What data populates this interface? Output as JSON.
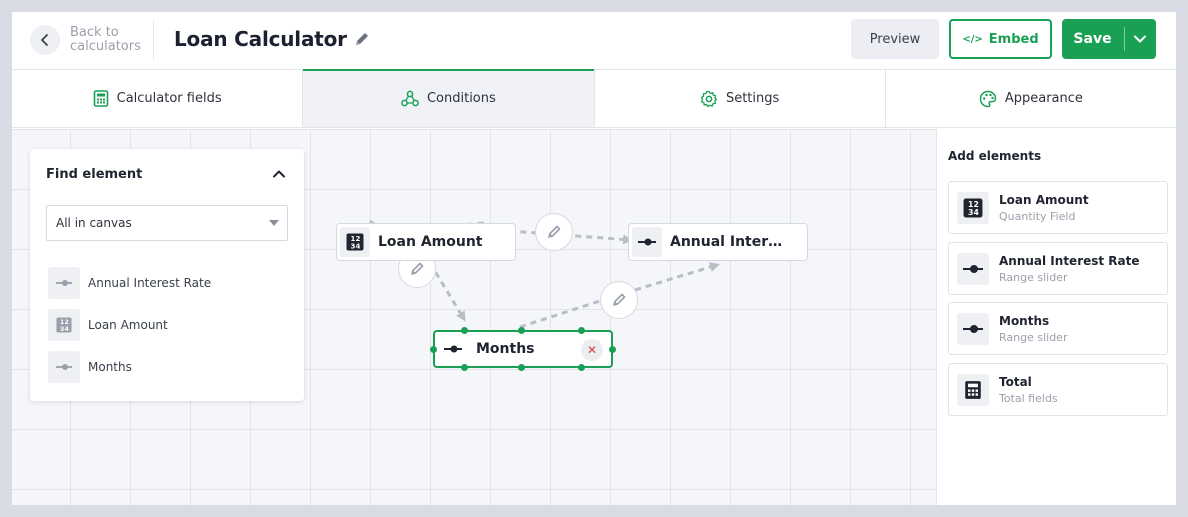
{
  "header": {
    "back_label": "Back to calculators",
    "title": "Loan Calculator",
    "preview_label": "Preview",
    "embed_label": "Embed",
    "save_label": "Save"
  },
  "tabs": [
    {
      "label": "Calculator fields",
      "icon": "calculator-icon"
    },
    {
      "label": "Conditions",
      "icon": "conditions-icon",
      "active": true
    },
    {
      "label": "Settings",
      "icon": "gear-icon"
    },
    {
      "label": "Appearance",
      "icon": "palette-icon"
    }
  ],
  "find_panel": {
    "title": "Find element",
    "select_value": "All in canvas",
    "items": [
      {
        "label": "Annual Interest Rate",
        "icon": "range-slider-icon"
      },
      {
        "label": "Loan Amount",
        "icon": "quantity-field-icon"
      },
      {
        "label": "Months",
        "icon": "range-slider-icon"
      }
    ]
  },
  "canvas": {
    "nodes": [
      {
        "label": "Loan Amount",
        "icon": "quantity-field-icon"
      },
      {
        "label": "Annual Inter…",
        "icon": "range-slider-icon"
      },
      {
        "label": "Months",
        "icon": "range-slider-icon",
        "selected": true
      }
    ]
  },
  "add_elements": {
    "title": "Add elements",
    "items": [
      {
        "name": "Loan Amount",
        "subtitle": "Quantity Field",
        "icon": "quantity-field-icon"
      },
      {
        "name": "Annual Interest Rate",
        "subtitle": "Range slider",
        "icon": "range-slider-icon"
      },
      {
        "name": "Months",
        "subtitle": "Range slider",
        "icon": "range-slider-icon"
      },
      {
        "name": "Total",
        "subtitle": "Total fields",
        "icon": "calculator-icon"
      }
    ]
  },
  "colors": {
    "accent": "#1aa055",
    "remove": "#e0403a"
  }
}
